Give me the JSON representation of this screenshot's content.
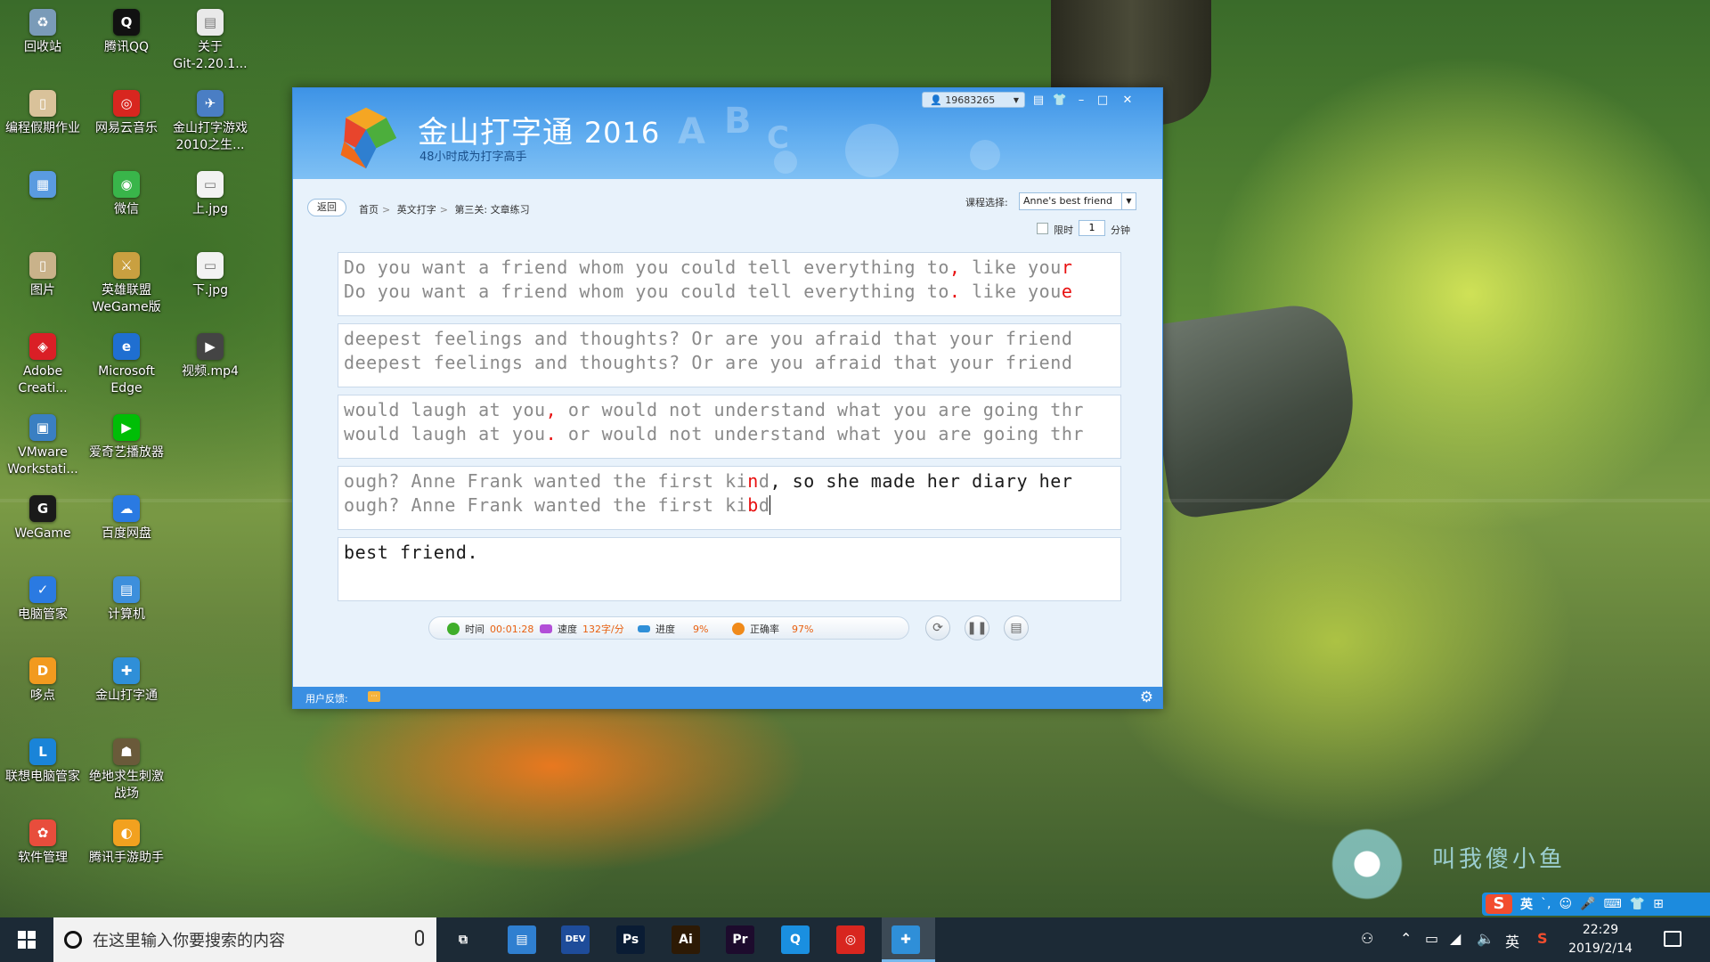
{
  "desktop": {
    "icons": [
      {
        "label": "回收站",
        "icon": "recycle-bin-icon",
        "color": "#7a9bb8",
        "glyph": "♻"
      },
      {
        "label": "腾讯QQ",
        "icon": "qq-icon",
        "color": "#111111",
        "glyph": "Q"
      },
      {
        "label": "关于\nGit-2.20.1...",
        "icon": "document-icon",
        "color": "#e9e9e9",
        "glyph": "▤"
      },
      {
        "label": "编程假期作业",
        "icon": "folder-icon",
        "color": "#d9c29a",
        "glyph": "▯"
      },
      {
        "label": "网易云音乐",
        "icon": "netease-music-icon",
        "color": "#d8261f",
        "glyph": "◎"
      },
      {
        "label": "金山打字游戏\n2010之生...",
        "icon": "typing-game-icon",
        "color": "#4a7ec4",
        "glyph": "✈"
      },
      {
        "label": "",
        "icon": "window-app-icon",
        "color": "#5a9be0",
        "glyph": "▦"
      },
      {
        "label": "微信",
        "icon": "wechat-icon",
        "color": "#39b54a",
        "glyph": "◉"
      },
      {
        "label": "上.jpg",
        "icon": "image-file-icon",
        "color": "#f2f2f2",
        "glyph": "▭"
      },
      {
        "label": "图片",
        "icon": "folder-icon",
        "color": "#c9b28a",
        "glyph": "▯"
      },
      {
        "label": "英雄联盟\nWeGame版",
        "icon": "lol-icon",
        "color": "#c9a040",
        "glyph": "⚔"
      },
      {
        "label": "下.jpg",
        "icon": "image-file-icon",
        "color": "#f2f2f2",
        "glyph": "▭"
      },
      {
        "label": "Adobe\nCreati...",
        "icon": "adobe-cc-icon",
        "color": "#da1f26",
        "glyph": "◈"
      },
      {
        "label": "Microsoft\nEdge",
        "icon": "edge-icon",
        "color": "#1f6fd1",
        "glyph": "e"
      },
      {
        "label": "视频.mp4",
        "icon": "video-file-icon",
        "color": "#444444",
        "glyph": "▶"
      },
      {
        "label": "VMware\nWorkstati...",
        "icon": "vmware-icon",
        "color": "#3a7fc2",
        "glyph": "▣"
      },
      {
        "label": "爱奇艺播放器",
        "icon": "iqiyi-icon",
        "color": "#00be06",
        "glyph": "▶"
      },
      {
        "label": "",
        "icon": "none",
        "color": "",
        "glyph": ""
      },
      {
        "label": "WeGame",
        "icon": "wegame-icon",
        "color": "#1a1a1a",
        "glyph": "G"
      },
      {
        "label": "百度网盘",
        "icon": "baidu-pan-icon",
        "color": "#2a7ae2",
        "glyph": "☁"
      },
      {
        "label": "",
        "icon": "none",
        "color": "",
        "glyph": ""
      },
      {
        "label": "电脑管家",
        "icon": "pc-manager-icon",
        "color": "#2a7ae2",
        "glyph": "✓"
      },
      {
        "label": "计算机",
        "icon": "computer-icon",
        "color": "#3d8fdc",
        "glyph": "▤"
      },
      {
        "label": "",
        "icon": "none",
        "color": "",
        "glyph": ""
      },
      {
        "label": "哆点",
        "icon": "duodian-icon",
        "color": "#f29a1f",
        "glyph": "D"
      },
      {
        "label": "金山打字通",
        "icon": "typing-master-icon",
        "color": "#2f8fd8",
        "glyph": "✚"
      },
      {
        "label": "",
        "icon": "none",
        "color": "",
        "glyph": ""
      },
      {
        "label": "联想电脑管家",
        "icon": "lenovo-manager-icon",
        "color": "#1a84d8",
        "glyph": "L"
      },
      {
        "label": "绝地求生刺激\n战场",
        "icon": "pubg-icon",
        "color": "#6a5a3a",
        "glyph": "☗"
      },
      {
        "label": "",
        "icon": "none",
        "color": "",
        "glyph": ""
      },
      {
        "label": "软件管理",
        "icon": "software-manager-icon",
        "color": "#e84d3c",
        "glyph": "✿"
      },
      {
        "label": "腾讯手游助手",
        "icon": "tencent-mobile-icon",
        "color": "#f2a11f",
        "glyph": "◐"
      }
    ],
    "watermark": "叫我傻小鱼"
  },
  "app": {
    "title": "金山打字通",
    "year": "2016",
    "subtitle": "48小时成为打字高手",
    "user_id": "19683265",
    "nav": {
      "back": "返回",
      "breadcrumb": [
        "首页",
        "英文打字",
        "第三关: 文章练习"
      ],
      "course_label": "课程选择:",
      "course_value": "Anne's best friend",
      "limit_label": "限时",
      "limit_value": "1",
      "limit_unit": "分钟"
    },
    "lines": [
      {
        "original": [
          {
            "t": "Do you want a friend whom you could tell everything to"
          },
          {
            "t": ",",
            "e": true
          },
          {
            "t": " like you"
          },
          {
            "t": "r",
            "e": true
          }
        ],
        "typed": [
          {
            "t": "Do you want a friend whom you could tell everything to"
          },
          {
            "t": ".",
            "e": true
          },
          {
            "t": " like you"
          },
          {
            "t": "e",
            "e": true
          }
        ]
      },
      {
        "original": [
          {
            "t": "deepest feelings and thoughts? Or are you afraid that your friend"
          }
        ],
        "typed": [
          {
            "t": "deepest feelings and thoughts? Or are you afraid that your friend"
          }
        ]
      },
      {
        "original": [
          {
            "t": "would laugh at you"
          },
          {
            "t": ",",
            "e": true
          },
          {
            "t": " or would not understand what you are going thr"
          }
        ],
        "typed": [
          {
            "t": "would laugh at you"
          },
          {
            "t": ".",
            "e": true
          },
          {
            "t": " or would not understand what you are going thr"
          }
        ]
      },
      {
        "original": [
          {
            "t": "ough? Anne Frank wanted the first ki"
          },
          {
            "t": "n",
            "e": true
          },
          {
            "t": "d"
          },
          {
            "t": ", so she made her diary her",
            "a": true
          }
        ],
        "typed": [
          {
            "t": "ough? Anne Frank wanted the first ki"
          },
          {
            "t": "b",
            "e": true
          },
          {
            "t": "d"
          }
        ],
        "caret": true
      },
      {
        "original": [
          {
            "t": "best friend.",
            "a": true
          }
        ],
        "typed": []
      }
    ],
    "stats": {
      "time_label": "时间",
      "time_value": "00:01:28",
      "speed_label": "速度",
      "speed_value": "132字/分",
      "progress_label": "进度",
      "progress_value": "9%",
      "accuracy_label": "正确率",
      "accuracy_value": "97%"
    },
    "footer": {
      "feedback_label": "用户反馈:"
    }
  },
  "ime": {
    "logo": "S",
    "mode": "英",
    "items": [
      "ˋ,",
      "☺",
      "🎤",
      "⌨",
      "👕",
      "⊞"
    ]
  },
  "taskbar": {
    "search_placeholder": "在这里输入你要搜索的内容",
    "apps": [
      {
        "name": "task-view-icon",
        "glyph": "⧉",
        "color": "transparent"
      },
      {
        "name": "computer-app-icon",
        "glyph": "▤",
        "color": "#2f7fd0"
      },
      {
        "name": "devcpp-icon",
        "glyph": "DEV",
        "color": "#1e4c9a"
      },
      {
        "name": "photoshop-icon",
        "glyph": "Ps",
        "color": "#0a1c34"
      },
      {
        "name": "illustrator-icon",
        "glyph": "Ai",
        "color": "#2d1a05"
      },
      {
        "name": "premiere-icon",
        "glyph": "Pr",
        "color": "#1d0b2d"
      },
      {
        "name": "qq-browser-icon",
        "glyph": "Q",
        "color": "#1a8fe0"
      },
      {
        "name": "netease-music-task-icon",
        "glyph": "◎",
        "color": "#d8261f"
      },
      {
        "name": "typing-master-task-icon",
        "glyph": "✚",
        "color": "#2f8fd8"
      }
    ],
    "tray": {
      "lang": "英",
      "time": "22:29",
      "date": "2019/2/14"
    }
  }
}
